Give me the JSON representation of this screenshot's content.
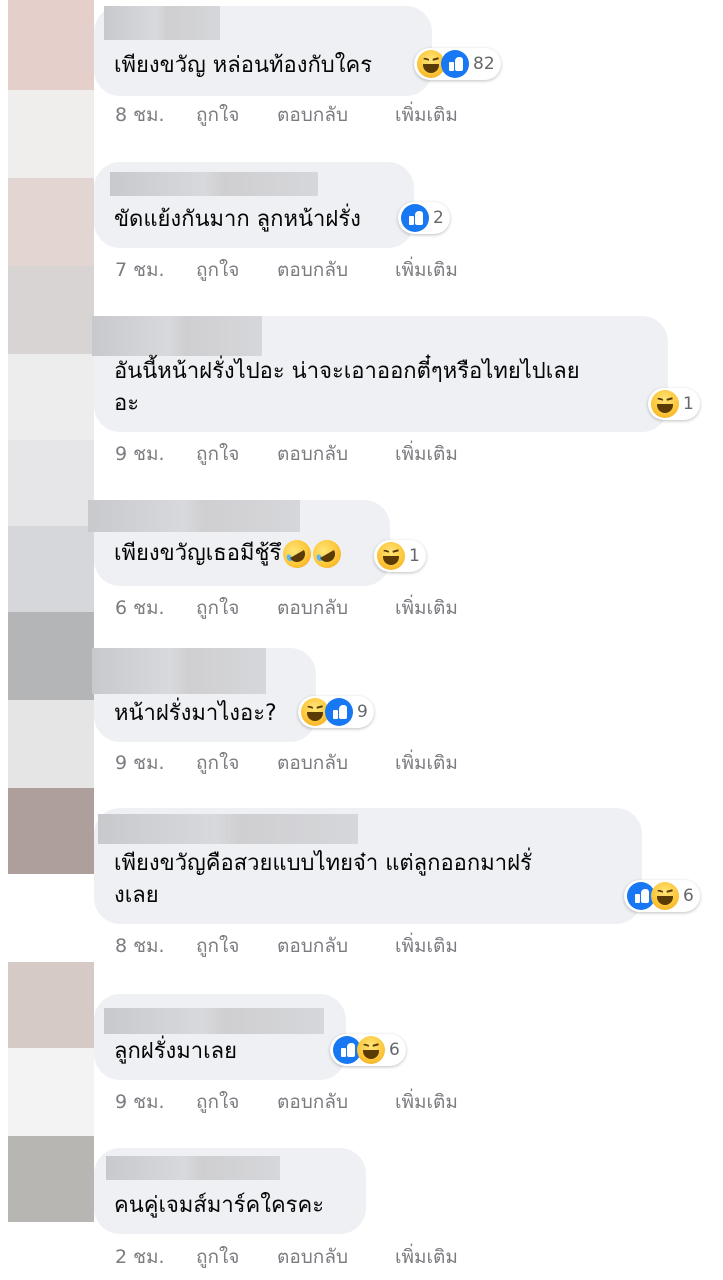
{
  "comments": [
    {
      "text_lines": [
        "เพียงขวัญ หล่อนท้องกับใคร"
      ],
      "time": "8 ชม.",
      "reaction_count": "82",
      "reactions": [
        "haha",
        "like"
      ]
    },
    {
      "text_lines": [
        "ขัดแย้งกันมาก ลูกหน้าฝรั่ง"
      ],
      "time": "7 ชม.",
      "reaction_count": "2",
      "reactions": [
        "like"
      ]
    },
    {
      "text_lines": [
        "อันนี้หน้าฝรั่งไปอะ น่าจะเอาออกตี๋ๆหรือไทยไปเลย",
        "อะ"
      ],
      "time": "9 ชม.",
      "reaction_count": "1",
      "reactions": [
        "haha"
      ]
    },
    {
      "text_lines": [
        "เพียงขวัญเธอมีชู้รึ"
      ],
      "time": "6 ชม.",
      "reaction_count": "1",
      "reactions": [
        "haha"
      ],
      "inline_emoji": [
        "rolling-on-floor-laughing",
        "rolling-on-floor-laughing"
      ]
    },
    {
      "text_lines": [
        "หน้าฝรั่งมาไงอะ?"
      ],
      "time": "9 ชม.",
      "reaction_count": "9",
      "reactions": [
        "haha",
        "like"
      ]
    },
    {
      "text_lines": [
        "เพียงขวัญคือสวยแบบไทยจ๋า แต่ลูกออกมาฝรั่",
        "งเลย"
      ],
      "time": "8 ชม.",
      "reaction_count": "6",
      "reactions": [
        "like",
        "haha"
      ]
    },
    {
      "text_lines": [
        "ลูกฝรั่งมาเลย"
      ],
      "time": "9 ชม.",
      "reaction_count": "6",
      "reactions": [
        "like",
        "haha"
      ]
    },
    {
      "text_lines": [
        "คนคู่เจมส์มาร์คใครคะ"
      ],
      "time": "2 ชม.",
      "reaction_count": "",
      "reactions": []
    }
  ],
  "actions": {
    "like": "ถูกใจ",
    "reply": "ตอบกลับ",
    "more": "เพิ่มเติม"
  },
  "colors": {
    "bubble": "#eef0f3",
    "meta_text": "#7a7c80",
    "like_blue": "#1877f2",
    "haha_yellow": "#fcc536"
  }
}
